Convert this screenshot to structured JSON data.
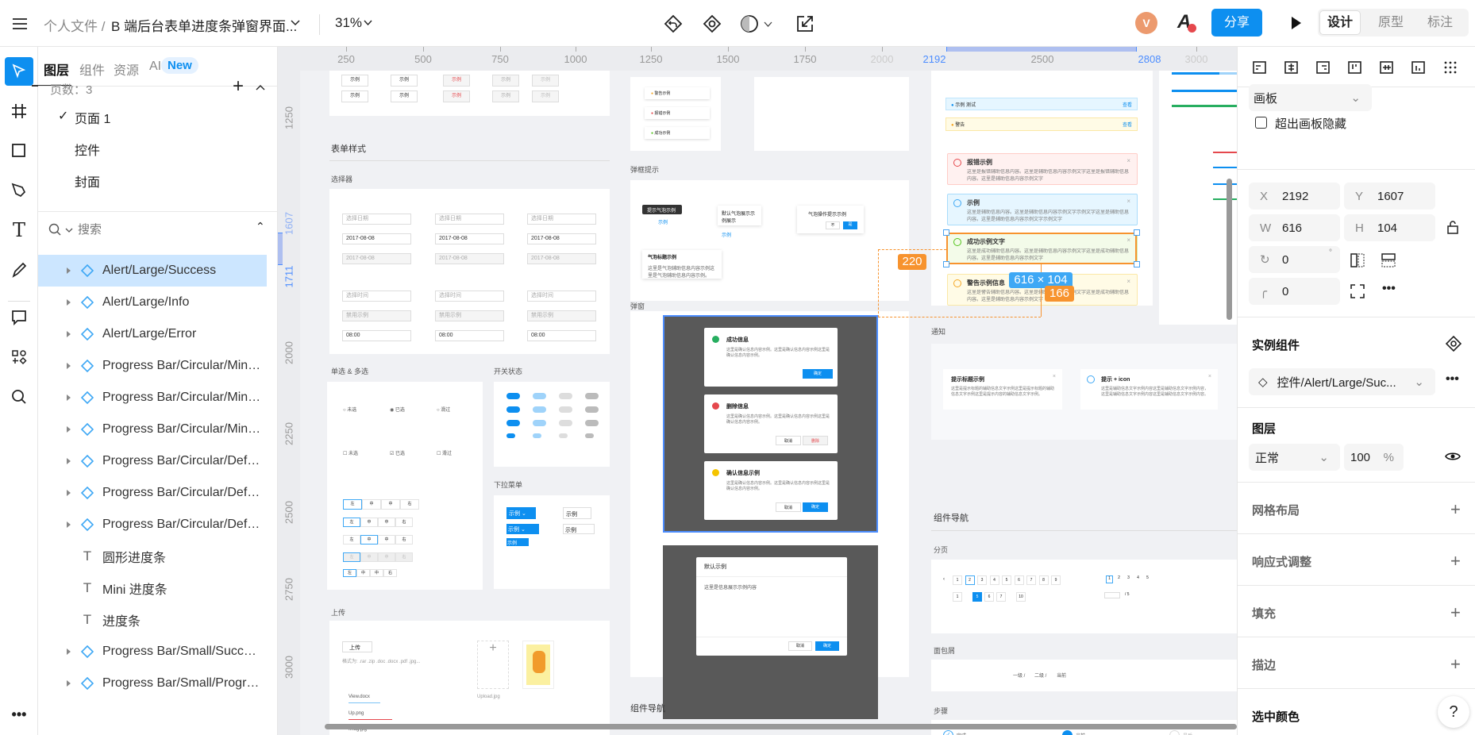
{
  "topbar": {
    "breadcrumb_root": "个人文件 /",
    "file_name": "B 端后台表单进度条弹窗界面...",
    "zoom": "31%",
    "avatar_letter": "V",
    "share_label": "分享",
    "modes": [
      "设计",
      "原型",
      "标注"
    ],
    "active_mode": "设计"
  },
  "layers_panel": {
    "tabs": [
      "图层",
      "组件",
      "资源",
      "AI"
    ],
    "new_badge": "New",
    "pages_label": "页数：3",
    "pages": [
      "页面 1",
      "控件",
      "封面"
    ],
    "search_placeholder": "搜索",
    "items": [
      {
        "type": "component",
        "name": "Alert/Large/Success",
        "selected": true
      },
      {
        "type": "component",
        "name": "Alert/Large/Info"
      },
      {
        "type": "component",
        "name": "Alert/Large/Error"
      },
      {
        "type": "component",
        "name": "Progress Bar/Circular/Mini/..."
      },
      {
        "type": "component",
        "name": "Progress Bar/Circular/Mini/..."
      },
      {
        "type": "component",
        "name": "Progress Bar/Circular/Mini/..."
      },
      {
        "type": "component",
        "name": "Progress Bar/Circular/Defau..."
      },
      {
        "type": "component",
        "name": "Progress Bar/Circular/Defau..."
      },
      {
        "type": "component",
        "name": "Progress Bar/Circular/Defau..."
      },
      {
        "type": "text",
        "name": "圆形进度条"
      },
      {
        "type": "text",
        "name": "Mini 进度条"
      },
      {
        "type": "text",
        "name": "进度条"
      },
      {
        "type": "component",
        "name": "Progress Bar/Small/Success"
      },
      {
        "type": "component",
        "name": "Progress Bar/Small/Progres..."
      }
    ]
  },
  "canvas": {
    "h_ruler": [
      "250",
      "500",
      "750",
      "1000",
      "1250",
      "1500",
      "1750",
      "2000",
      "2500",
      "3000"
    ],
    "h_ruler_selection": [
      "2192",
      "2808"
    ],
    "v_ruler": [
      "1250",
      "2000",
      "2250",
      "2500",
      "2750",
      "3000"
    ],
    "v_ruler_selection": [
      "1607",
      "1711"
    ],
    "sections": {
      "form_style": "表单样式",
      "picker": "选择器",
      "radio_check": "单选 & 多选",
      "switch": "开关状态",
      "dropdown": "下拉菜单",
      "upload": "上传",
      "tooltip": "弹框提示",
      "modal": "弹窗",
      "notice": "通知",
      "nav": "组件导航",
      "pagination": "分页",
      "breadcrumb": "面包屑",
      "steps": "步骤"
    },
    "buttons_sample": "示例",
    "date_inputs": [
      "选择日期",
      "2017-08-08",
      "2017-08-08"
    ],
    "time_inputs": [
      "选择时间",
      "禁用示例",
      "08:00"
    ],
    "radio_options": [
      "未选",
      "已选",
      "滑过"
    ],
    "segmented": [
      "左",
      "中",
      "中",
      "右"
    ],
    "messages": [
      "警告示例",
      "报错示例",
      "成功示例"
    ],
    "tooltip_dark": "提示气泡示例",
    "tooltip_link": "示例",
    "popover_text": "默认气泡展示示例展示",
    "confirm_text": "气泡操作提示示例",
    "confirm_no": "不",
    "confirm_yes": "是",
    "popover_title": "气泡标题示例",
    "popover_body": "这里是气泡辅助信息内容示例这里是气泡辅助信息内容示例。",
    "alerts": [
      {
        "title": "报错示例",
        "body": "这里是报错辅助信息内容。这里是辅助信息内容示例文字这里是报错辅助信息内容。这里是辅助信息内容示例文字",
        "kind": "error"
      },
      {
        "title": "示例",
        "body": "这里是辅助信息内容。这里是辅助信息内容示例文字示例文字这里是辅助信息内容。这里是辅助信息内容示例文字示例文字",
        "kind": "info"
      },
      {
        "title": "成功示例文字",
        "body": "这里是成功辅助信息内容。这里是辅助信息内容示例文字这里是成功辅助信息内容。这里是辅助信息内容示例文字",
        "kind": "success"
      },
      {
        "title": "警告示例信息",
        "body": "这里是警告辅助信息内容。这里是辅助信息内容示例文字这里是成功辅助信息内容。这里是辅助信息内容示例文字",
        "kind": "warning"
      }
    ],
    "small_alerts": [
      {
        "text": "示例 测试",
        "link": "查看"
      },
      {
        "text": "警告",
        "link": "查看"
      }
    ],
    "modals": [
      {
        "title": "成功信息",
        "body": "这里是确认信息内容示例。这里是确认信息内容示例这里是确认信息内容示例。",
        "buttons": [
          "确定"
        ]
      },
      {
        "title": "删除信息",
        "body": "这里是确认信息内容示例。这里是确认信息内容示例这里是确认信息内容示例。",
        "buttons": [
          "取消",
          "删除"
        ]
      },
      {
        "title": "确认信息示例",
        "body": "这里是确认信息内容示例。这里是确认信息内容示例这里是确认信息内容示例。",
        "buttons": [
          "取消",
          "确定"
        ]
      }
    ],
    "default_modal": {
      "title": "默认示例",
      "body": "这里是信息展示示例内容",
      "buttons": [
        "取消",
        "确定"
      ]
    },
    "notices": [
      {
        "title": "提示标题示例",
        "body": "这里是提示标题的辅助信息文字示例这里是提示标题的辅助信息文字示例这里是提示内容的辅助信息文字示例。"
      },
      {
        "title": "提示 + icon",
        "body": "这里是辅助信息文字示例内容这里是辅助信息文字示例内容，这里是辅助信息文字示例内容这里是辅助信息文字示例内容。"
      }
    ],
    "pages_row1": [
      "1",
      "2",
      "3",
      "4",
      "5",
      "6",
      "7",
      "8",
      "9"
    ],
    "pages_row2": [
      "1",
      "5",
      "6",
      "7",
      "10"
    ],
    "mini_pages": [
      "1",
      "2",
      "3",
      "4",
      "5"
    ],
    "page_jump": "/ 5",
    "breadcrumb_items": [
      "一级 /",
      "二级 /",
      "当前"
    ],
    "steps": [
      "完成",
      "当前",
      "最后"
    ],
    "upload_btn": "上传",
    "upload_hint": "格式为: .rar .zip .doc .docx .pdf .jpg...",
    "upload_files": [
      "View.docx",
      "Up.png",
      "Imag.jpg"
    ],
    "upload_image_name": "Upload.jpg",
    "measure": {
      "size": "616 × 104",
      "left_gap": "220",
      "bottom_gap": "166"
    }
  },
  "right_panel": {
    "frame_type": "画板",
    "clip_label": "超出画板隐藏",
    "clip_checked": false,
    "x": "2192",
    "y": "1607",
    "w": "616",
    "h": "104",
    "rotation": "0",
    "radius": "0",
    "instance_title": "实例组件",
    "instance_name": "控件/Alert/Large/Suc...",
    "layer_title": "图层",
    "blend": "正常",
    "opacity": "100",
    "opacity_unit": "%",
    "sections": [
      "网格布局",
      "响应式调整",
      "填充",
      "描边"
    ],
    "selected_color_title": "选中颜色",
    "help": "?"
  },
  "colors": {
    "accent": "#0d8ff0",
    "selection": "#cce6ff",
    "measure": "#f7932e",
    "component": "#3ea8f5"
  }
}
